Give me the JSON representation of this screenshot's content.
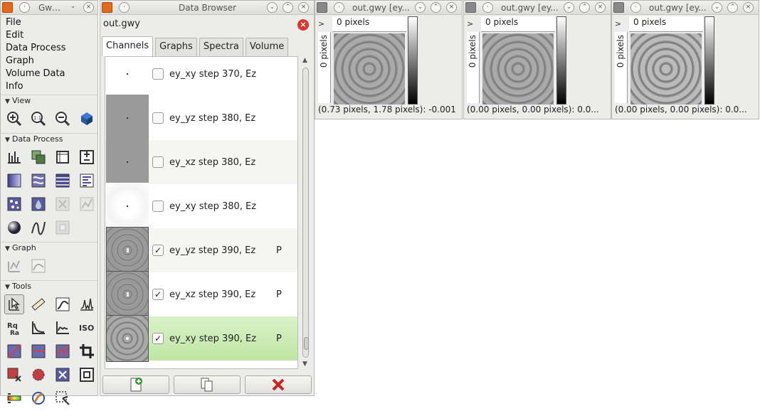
{
  "toolbox": {
    "title": "Gw…",
    "menu": [
      "File",
      "Edit",
      "Data Process",
      "Graph",
      "Volume Data",
      "Info"
    ],
    "sections": {
      "view": "View",
      "data_process": "Data Process",
      "graph": "Graph",
      "tools": "Tools"
    }
  },
  "browser": {
    "title": "Data Browser",
    "file": "out.gwy",
    "tabs": [
      "Channels",
      "Graphs",
      "Spectra",
      "Volume"
    ],
    "channels": [
      {
        "label": "ey_xy step 370, Ez",
        "checked": false,
        "flag": ""
      },
      {
        "label": "ey_yz step 380, Ez",
        "checked": false,
        "flag": ""
      },
      {
        "label": "ey_xz step 380, Ez",
        "checked": false,
        "flag": ""
      },
      {
        "label": "ey_xy step 380, Ez",
        "checked": false,
        "flag": ""
      },
      {
        "label": "ey_yz step 390, Ez",
        "checked": true,
        "flag": "P"
      },
      {
        "label": "ey_xz step 390, Ez",
        "checked": true,
        "flag": "P"
      },
      {
        "label": "ey_xy step 390, Ez",
        "checked": true,
        "flag": "P"
      }
    ],
    "check_mark": "✓"
  },
  "channel_windows": [
    {
      "title": "out.gwy [ey...",
      "ruler_h": "0 pixels",
      "ruler_v": "0 pixels",
      "status": "(0.73 pixels, 1.78 pixels): -0.001"
    },
    {
      "title": "out.gwy [ey...",
      "ruler_h": "0 pixels",
      "ruler_v": "0 pixels",
      "status": "(0.00 pixels, 0.00 pixels): 0.0..."
    },
    {
      "title": "out.gwy [ey...",
      "ruler_h": "0 pixels",
      "ruler_v": "0 pixels",
      "status": "(0.00 pixels, 0.00 pixels): 0.0..."
    }
  ],
  "colors": {
    "selected_row": "#c6eaae",
    "close_red": "#d53a2e"
  }
}
